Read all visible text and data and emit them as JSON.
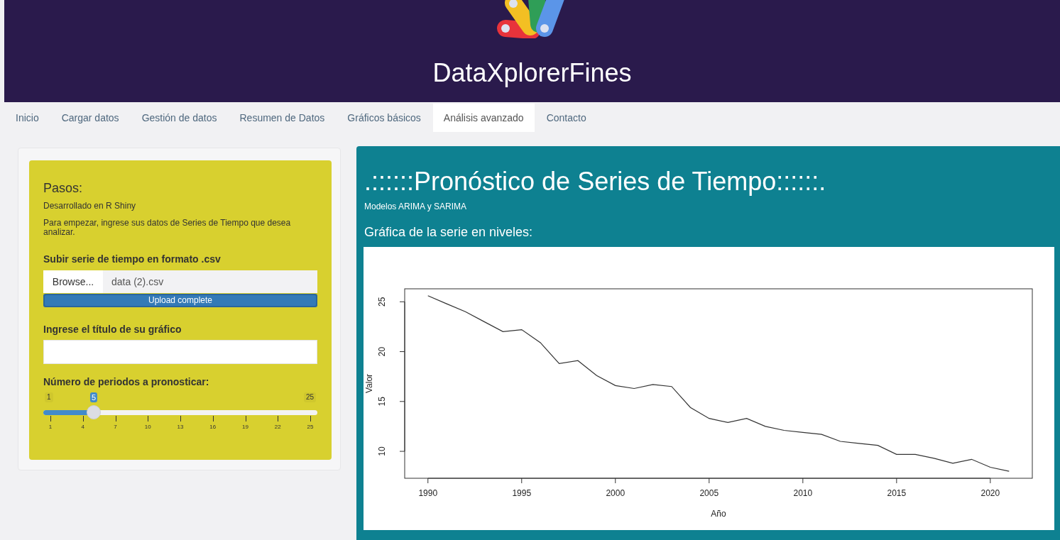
{
  "header": {
    "title": "DataXplorerFines"
  },
  "tabs": [
    {
      "label": "Inicio",
      "selected": false
    },
    {
      "label": "Cargar datos",
      "selected": false
    },
    {
      "label": "Gestión de datos",
      "selected": false
    },
    {
      "label": "Resumen de Datos",
      "selected": false
    },
    {
      "label": "Gráficos básicos",
      "selected": false
    },
    {
      "label": "Análisis avanzado",
      "selected": true
    },
    {
      "label": "Contacto",
      "selected": false
    }
  ],
  "sidebar": {
    "heading": "Pasos:",
    "notes": [
      "Desarrollado en R Shiny",
      "Para empezar, ingrese sus datos de Series de Tiempo que desea analizar."
    ],
    "file_input": {
      "label": "Subir serie de tiempo en formato .csv",
      "button": "Browse...",
      "value": "data (2).csv",
      "progress": {
        "text": "Upload complete",
        "level": 1
      }
    },
    "title_input": {
      "label": "Ingrese el título de su gráfico"
    },
    "slider": {
      "label": "Número de periodos a pronosticar:",
      "min_label": "1",
      "max_label": "25",
      "value_label": "5",
      "level": 0.1667,
      "tick_labels": [
        "1",
        "4",
        "7",
        "10",
        "13",
        "16",
        "19",
        "22",
        "25"
      ]
    }
  },
  "main": {
    "title": ".::::::Pronóstico de Series de Tiempo::::::.",
    "subtitle": "Modelos ARIMA y SARIMA",
    "chart_heading": "Gráfica de la serie en niveles:",
    "chart_data": {
      "type": "line",
      "xlabel": "Año",
      "ylabel": "Valor",
      "x": [
        1990,
        1991,
        1992,
        1993,
        1994,
        1995,
        1996,
        1997,
        1998,
        1999,
        2000,
        2001,
        2002,
        2003,
        2004,
        2005,
        2006,
        2007,
        2008,
        2009,
        2010,
        2011,
        2012,
        2013,
        2014,
        2015,
        2016,
        2017,
        2018,
        2019,
        2020,
        2021
      ],
      "values": [
        25.6,
        24.8,
        24.0,
        23.0,
        22.0,
        22.2,
        20.9,
        18.8,
        19.1,
        17.6,
        16.6,
        16.3,
        16.7,
        16.5,
        14.4,
        13.3,
        12.9,
        13.3,
        12.5,
        12.1,
        11.9,
        11.7,
        11.0,
        10.8,
        10.6,
        9.7,
        9.7,
        9.3,
        8.8,
        9.2,
        8.4,
        8.0
      ],
      "xlim": [
        1988.76,
        2022.24
      ],
      "ylim": [
        7.3,
        26.3
      ],
      "xticks": [
        1990,
        1995,
        2000,
        2005,
        2010,
        2015,
        2020
      ],
      "yticks": [
        10,
        15,
        20,
        25
      ]
    }
  }
}
